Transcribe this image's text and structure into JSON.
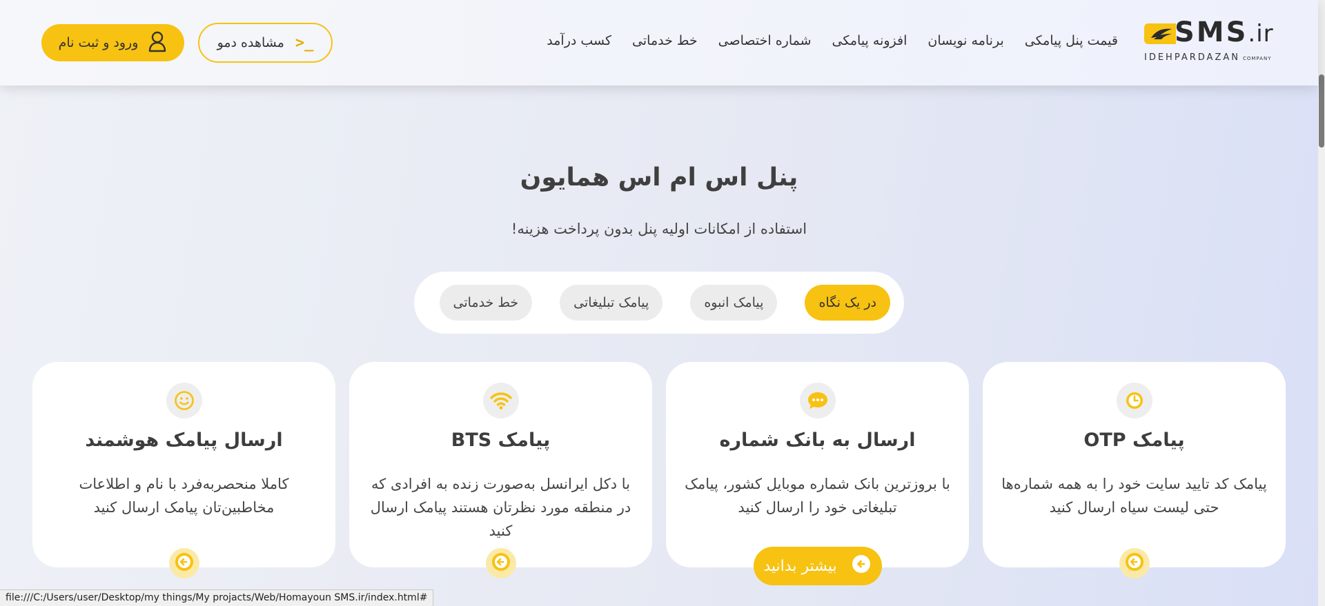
{
  "colors": {
    "accent": "#f7c211",
    "accent_soft": "#fbeaa7",
    "text": "#444444"
  },
  "header": {
    "logo": {
      "text_main": "SMS",
      "text_ext": ".ir",
      "subtitle": "IDEHPARDAZAN",
      "subtitle_small": "COMPANY"
    },
    "nav": [
      "قیمت پنل پیامکی",
      "برنامه نویسان",
      "افزونه پیامکی",
      "شماره اختصاصی",
      "خط خدماتی",
      "کسب درآمد"
    ],
    "demo_label": "مشاهده دمو",
    "demo_icon_text": ">_",
    "login_label": "ورود و ثبت نام"
  },
  "hero": {
    "title": "پنل اس ام اس همایون",
    "subtitle": "استفاده از امکانات اولیه پنل بدون پرداخت هزینه!"
  },
  "tabs": [
    {
      "label": "در یک نگاه",
      "active": true
    },
    {
      "label": "پیامک انبوه",
      "active": false
    },
    {
      "label": "پیامک تبلیغاتی",
      "active": false
    },
    {
      "label": "خط خدماتی",
      "active": false
    }
  ],
  "cards": [
    {
      "title": "پیامک OTP",
      "desc": "پیامک کد تایید سایت خود را به همه شماره‌ها حتی لیست سیاه ارسال کنید",
      "icon": "clock-icon"
    },
    {
      "title": "ارسال به بانک شماره",
      "desc": "با بروزترین بانک شماره موبایل کشور، پیامک تبلیغاتی خود را ارسال کنید",
      "icon": "chat-bubble-icon"
    },
    {
      "title": "پیامک BTS",
      "desc": "با دکل ایرانسل به‌صورت زنده به افرادی که در منطقه مورد نظرتان هستند پیامک ارسال کنید",
      "icon": "wifi-icon"
    },
    {
      "title": "ارسال پیامک هوشمند",
      "desc": "کاملا منحصربه‌فرد با نام و اطلاعات مخاطبین‌تان پیامک ارسال کنید",
      "icon": "smiley-icon"
    }
  ],
  "more_label": "بیشتر بدانید",
  "status_url": "file:///C:/Users/user/Desktop/my things/My projacts/Web/Homayoun SMS.ir/index.html#"
}
